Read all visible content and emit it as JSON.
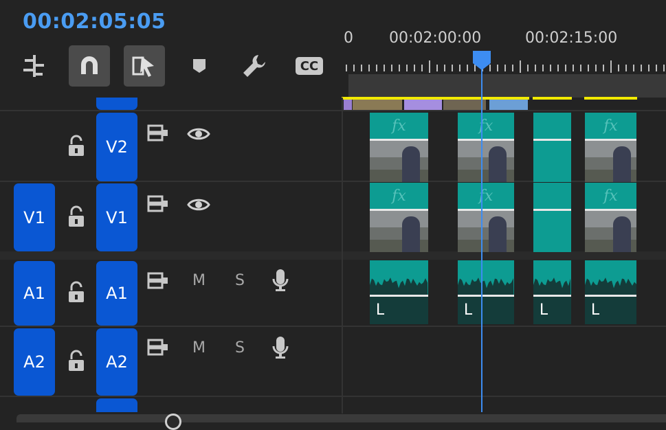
{
  "timeline": {
    "timecode": "00:02:05:05",
    "ruler": {
      "labels": [
        "0",
        "00:02:00:00",
        "00:02:15:00"
      ]
    },
    "toolbar": {
      "icons": [
        "nest-sequence-icon",
        "snap-magnet-icon",
        "linked-selection-icon",
        "add-marker-icon",
        "wrench-settings-icon",
        "captions-icon"
      ],
      "captions_label": "CC"
    },
    "tracks": {
      "v2": {
        "source_label": "",
        "target_label": "V2"
      },
      "v1": {
        "source_label": "V1",
        "target_label": "V1"
      },
      "a1": {
        "source_label": "A1",
        "target_label": "A1",
        "mute": "M",
        "solo": "S"
      },
      "a2": {
        "source_label": "A2",
        "target_label": "A2",
        "mute": "M",
        "solo": "S"
      }
    },
    "clips": {
      "fx_label": "fx",
      "audio_channel_label": "L"
    },
    "colors": {
      "accent": "#4a9cf2",
      "track_button": "#0a57d3",
      "clip_teal": "#0d9c92",
      "render_bar_yellow": "#f2ea00",
      "playhead": "#3d8df2"
    }
  }
}
